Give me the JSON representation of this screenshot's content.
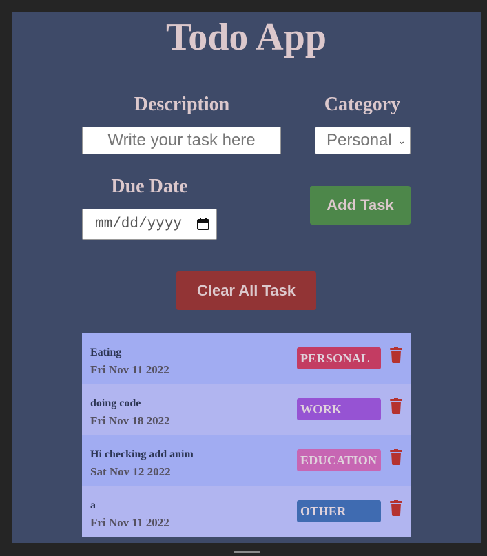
{
  "app": {
    "title": "Todo App"
  },
  "form": {
    "description_label": "Description",
    "description_placeholder": "Write your task here",
    "category_label": "Category",
    "category_selected": "Personal",
    "due_date_label": "Due Date",
    "due_date_placeholder": "mm/dd/yyyy",
    "add_button": "Add Task",
    "clear_button": "Clear All Task"
  },
  "tasks": [
    {
      "text": "Eating",
      "date": "Fri Nov 11 2022",
      "category": "PERSONAL",
      "color": "#c33c62"
    },
    {
      "text": "doing code",
      "date": "Fri Nov 18 2022",
      "category": "WORK",
      "color": "#9653d3"
    },
    {
      "text": "Hi checking add anim",
      "date": "Sat Nov 12 2022",
      "category": "EDUCATION",
      "color": "#c766b3"
    },
    {
      "text": "a",
      "date": "Fri Nov 11 2022",
      "category": "OTHER",
      "color": "#3f6bb1"
    }
  ],
  "colors": {
    "trash": "#b5322f"
  }
}
